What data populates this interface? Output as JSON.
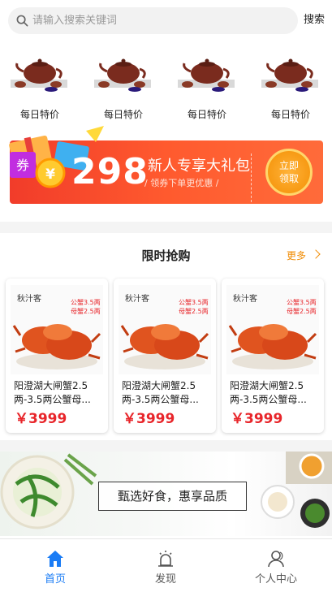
{
  "search": {
    "placeholder": "请输入搜索关键词",
    "button_label": "搜索"
  },
  "categories": [
    {
      "label": "每日特价",
      "icon": "teapot-icon"
    },
    {
      "label": "每日特价",
      "icon": "teapot-icon"
    },
    {
      "label": "每日特价",
      "icon": "teapot-icon"
    },
    {
      "label": "每日特价",
      "icon": "teapot-icon"
    }
  ],
  "promo_banner": {
    "coupon_tag": "券",
    "amount": "298",
    "title": "新人专享大礼包",
    "subtitle": "/ 领券下单更优惠 /",
    "cta_line1": "立即",
    "cta_line2": "领取",
    "colors": {
      "primary": "#f13c2a",
      "cta": "#f79a14"
    }
  },
  "flash_sale": {
    "title": "限时抢购",
    "more_label": "更多",
    "products": [
      {
        "brand": "秋汁客",
        "tag_line1": "公蟹3.5两",
        "tag_line2": "母蟹2.5两",
        "name": "阳澄湖大闸蟹2.5两-3.5两公蟹母...",
        "price": "￥3999"
      },
      {
        "brand": "秋汁客",
        "tag_line1": "公蟹3.5两",
        "tag_line2": "母蟹2.5两",
        "name": "阳澄湖大闸蟹2.5两-3.5两公蟹母...",
        "price": "￥3999"
      },
      {
        "brand": "秋汁客",
        "tag_line1": "公蟹3.5两",
        "tag_line2": "母蟹2.5两",
        "name": "阳澄湖大闸蟹2.5两-3.5两公蟹母...",
        "price": "￥3999"
      }
    ]
  },
  "food_banner": {
    "slogan": "甄选好食，惠享品质"
  },
  "tabbar": {
    "items": [
      {
        "label": "首页",
        "icon": "home-icon",
        "active": true
      },
      {
        "label": "发现",
        "icon": "discover-icon",
        "active": false
      },
      {
        "label": "个人中心",
        "icon": "user-icon",
        "active": false
      }
    ],
    "active_color": "#1a7cf5"
  }
}
